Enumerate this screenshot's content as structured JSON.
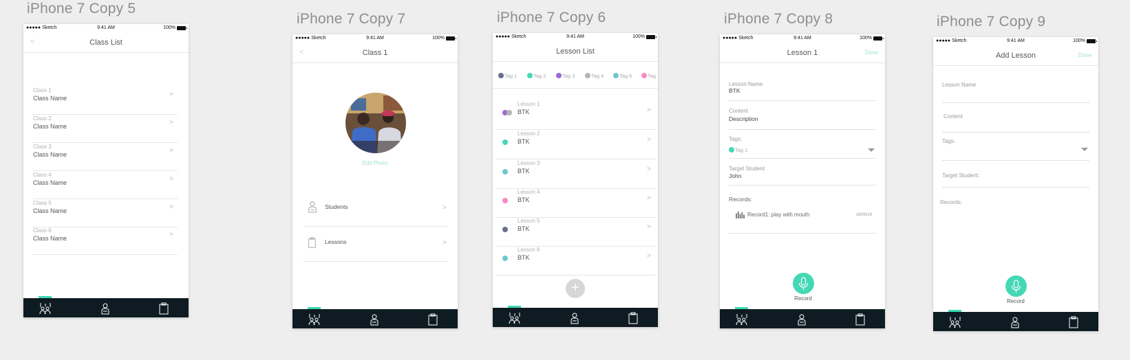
{
  "artboards": [
    {
      "title": "iPhone 7 Copy 5"
    },
    {
      "title": "iPhone 7 Copy 7"
    },
    {
      "title": "iPhone 7 Copy 6"
    },
    {
      "title": "iPhone 7 Copy 8"
    },
    {
      "title": "iPhone 7 Copy 9"
    }
  ],
  "statusbar": {
    "carrier": "●●●●● Sketch",
    "time": "9:41 AM",
    "battery": "100%"
  },
  "colors": {
    "accent": "#45d8b5",
    "tabbar": "#0e1b22",
    "indicator": "#38d9b2"
  },
  "tabbar_icons": [
    "hands-raised-icon",
    "student-icon",
    "clipboard-icon"
  ],
  "class_list": {
    "back": "<",
    "title": "Class List",
    "rows": [
      {
        "sub": "Class 1",
        "main": "Class Name",
        "chevron": ">"
      },
      {
        "sub": "Class 2",
        "main": "Class Name",
        "chevron": ">"
      },
      {
        "sub": "Class 3",
        "main": "Class Name",
        "chevron": ">"
      },
      {
        "sub": "Class 4",
        "main": "Class Name",
        "chevron": ">"
      },
      {
        "sub": "Class 5",
        "main": "Class Name",
        "chevron": ">"
      },
      {
        "sub": "Class 6",
        "main": "Class Name",
        "chevron": ">"
      }
    ]
  },
  "class_detail": {
    "back": "<",
    "title": "Class 1",
    "edit_photo": "Edit Photo",
    "menu": [
      {
        "label": "Students",
        "chevron": ">",
        "icon": "student-icon"
      },
      {
        "label": "Lessons",
        "chevron": ">",
        "icon": "clipboard-icon"
      }
    ]
  },
  "lesson_list": {
    "title": "Lesson List",
    "tags": [
      {
        "label": "Tag 1",
        "color": "#6b6f8e"
      },
      {
        "label": "Tag 2",
        "color": "#45d8b5"
      },
      {
        "label": "Tag 3",
        "color": "#9b6bd1"
      },
      {
        "label": "Tag 4",
        "color": "#b5b5b5"
      },
      {
        "label": "Tag 5",
        "color": "#6cc9cf"
      },
      {
        "label": "Tag",
        "color": "#f58bc2"
      }
    ],
    "rows": [
      {
        "sub": "Lesson 1",
        "main": "BTK",
        "chevron": ">",
        "colors": [
          "#9b6bd1",
          "#b5b5b5"
        ]
      },
      {
        "sub": "Lesson 2",
        "main": "BTK",
        "chevron": ">",
        "colors": [
          "#45d8b5"
        ]
      },
      {
        "sub": "Lesson 3",
        "main": "BTK",
        "chevron": ">",
        "colors": [
          "#6cc9cf"
        ]
      },
      {
        "sub": "Lesson 4",
        "main": "BTK",
        "chevron": ">",
        "colors": [
          "#f58bc2"
        ]
      },
      {
        "sub": "Lesson 5",
        "main": "BTK",
        "chevron": ">",
        "colors": [
          "#6b6f8e"
        ]
      },
      {
        "sub": "Lesson 6",
        "main": "BTK",
        "chevron": ">",
        "colors": [
          "#6cc9cf"
        ]
      }
    ],
    "add_symbol": "+"
  },
  "lesson_detail": {
    "title": "Lesson 1",
    "done": "Done",
    "lesson_name_label": "Lesson Name",
    "lesson_name_value": "BTK",
    "content_label": "Content",
    "content_value": "Description",
    "tags_label": "Tags:",
    "tag_value": "Tag 1",
    "tag_color": "#45d8b5",
    "target_label": "Target Student",
    "target_value": "John",
    "records_label": "Records:",
    "record_name": "Record1: play with mouth",
    "record_date": "16/09/19",
    "record_button": "Record"
  },
  "add_lesson": {
    "title": "Add Lesson",
    "done": "Done",
    "lesson_name_label": "Lesson Name",
    "content_label": "Content",
    "tags_label": "Tags:",
    "target_label": "Target Student:",
    "records_label": "Records:",
    "record_button": "Record"
  }
}
